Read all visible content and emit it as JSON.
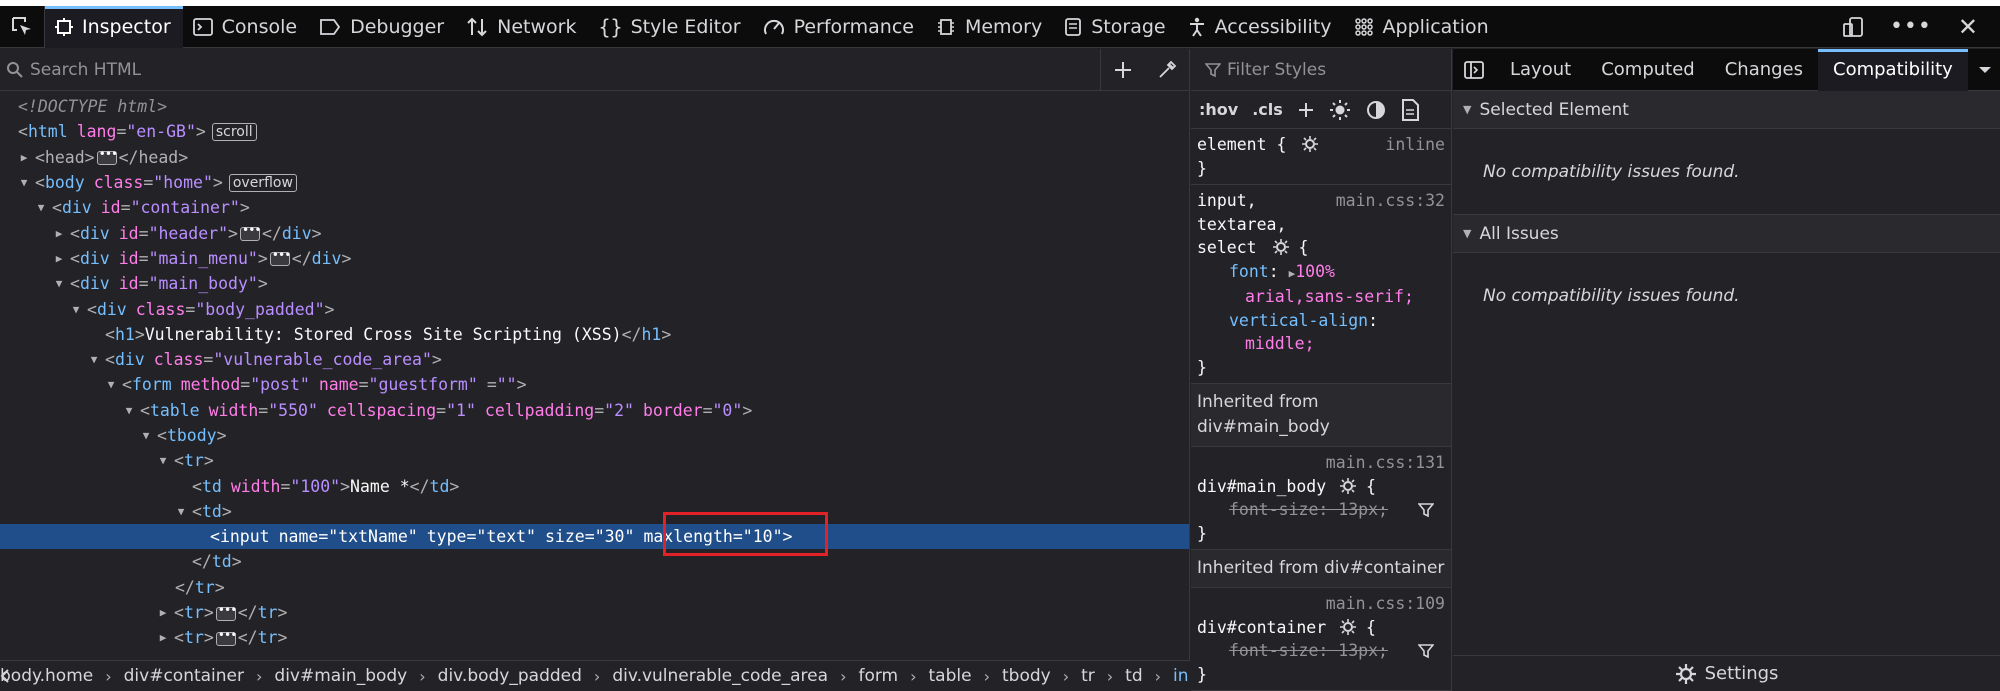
{
  "toolbar": {
    "tabs": [
      {
        "label": "Inspector",
        "icon": "inspector-icon"
      },
      {
        "label": "Console",
        "icon": "console-icon"
      },
      {
        "label": "Debugger",
        "icon": "debugger-icon"
      },
      {
        "label": "Network",
        "icon": "network-icon"
      },
      {
        "label": "Style Editor",
        "icon": "style-editor-icon"
      },
      {
        "label": "Performance",
        "icon": "performance-icon"
      },
      {
        "label": "Memory",
        "icon": "memory-icon"
      },
      {
        "label": "Storage",
        "icon": "storage-icon"
      },
      {
        "label": "Accessibility",
        "icon": "accessibility-icon"
      },
      {
        "label": "Application",
        "icon": "application-icon"
      }
    ],
    "selected": "Inspector"
  },
  "markup": {
    "search_placeholder": "Search HTML",
    "rows": {
      "doctype": "<!DOCTYPE html>",
      "html_tag": "html",
      "html_attr": "lang",
      "html_val": "\"en-GB\"",
      "html_badge": "scroll",
      "head_open": "<head>",
      "head_close": "</head>",
      "body_attr": "class",
      "body_val": "\"home\"",
      "body_badge": "overflow",
      "container_val": "\"container\"",
      "header_val": "\"header\"",
      "mainmenu_val": "\"main_menu\"",
      "mainbody_val": "\"main_body\"",
      "bodypadded_val": "\"body_padded\"",
      "h1_text": "Vulnerability: Stored Cross Site Scripting (XSS)",
      "vulnarea_val": "\"vulnerable_code_area\"",
      "form_method": "\"post\"",
      "form_name": "\"guestform\"",
      "form_extra_attr": "\"\"",
      "table_width": "\"550\"",
      "table_cellspacing": "\"1\"",
      "table_cellpadding": "\"2\"",
      "table_border": "\"0\"",
      "td_width": "\"100\"",
      "td_text": "Name *",
      "input_name": "\"txtName\"",
      "input_type": "\"text\"",
      "input_size": "\"30\"",
      "input_maxlength": "\"10\""
    }
  },
  "breadcrumbs": [
    "body.home",
    "div#container",
    "div#main_body",
    "div.body_padded",
    "div.vulnerable_code_area",
    "form",
    "table",
    "tbody",
    "tr",
    "td",
    "input"
  ],
  "rules": {
    "filter_placeholder": "Filter Styles",
    "tools": [
      ":hov",
      ".cls"
    ],
    "element_selector": "element {",
    "element_src": "inline",
    "rule1_selector_lines": [
      "input,",
      "textarea,",
      "select"
    ],
    "rule1_src": "main.css:32",
    "rule1_props": [
      {
        "name": "font",
        "value": "100%"
      },
      {
        "name": "",
        "value": "arial,sans-serif;"
      },
      {
        "name": "vertical-align",
        "value": ""
      },
      {
        "name": "",
        "value": "middle;"
      }
    ],
    "inherited1": "Inherited from div#main_body",
    "rule2_src": "main.css:131",
    "rule2_selector": "div#main_body",
    "rule2_prop": "font-size: 13px;",
    "inherited2": "Inherited from div#container",
    "rule3_src": "main.css:109",
    "rule3_selector": "div#container",
    "rule3_prop": "font-size: 13px;"
  },
  "sidepanel": {
    "tabs": [
      "Layout",
      "Computed",
      "Changes",
      "Compatibility"
    ],
    "selected": "Compatibility",
    "sections": [
      {
        "title": "Selected Element",
        "message": "No compatibility issues found."
      },
      {
        "title": "All Issues",
        "message": "No compatibility issues found."
      }
    ],
    "settings_label": "Settings"
  }
}
